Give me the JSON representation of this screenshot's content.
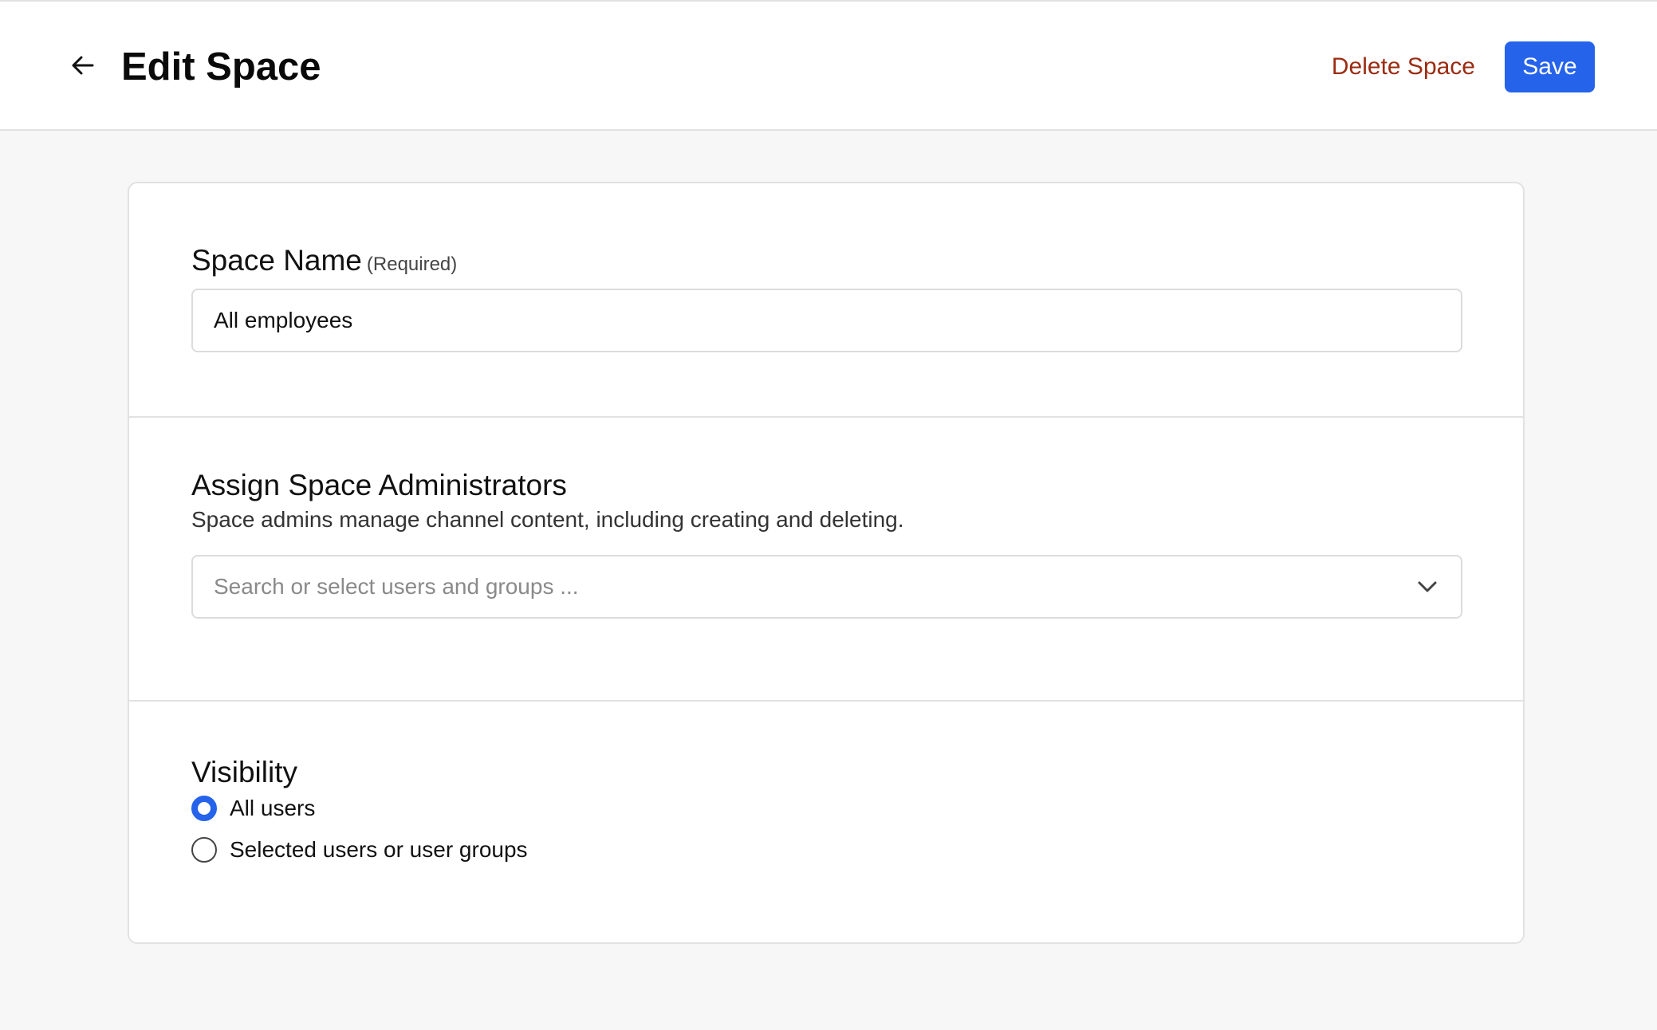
{
  "header": {
    "title": "Edit Space",
    "back_icon": "arrow-left-icon",
    "delete_label": "Delete Space",
    "save_label": "Save"
  },
  "space_name": {
    "label": "Space Name",
    "required_hint": "(Required)",
    "value": "All employees"
  },
  "admins": {
    "label": "Assign Space Administrators",
    "description": "Space admins manage channel content, including creating and deleting.",
    "placeholder": "Search or select users and groups ...",
    "dropdown_icon": "chevron-down-icon"
  },
  "visibility": {
    "label": "Visibility",
    "options": [
      {
        "label": "All users",
        "checked": true
      },
      {
        "label": "Selected users or user groups",
        "checked": false
      }
    ]
  },
  "colors": {
    "accent": "#2563eb",
    "danger": "#9b2c12",
    "background": "#f7f7f7",
    "border": "#e2e2e2"
  }
}
